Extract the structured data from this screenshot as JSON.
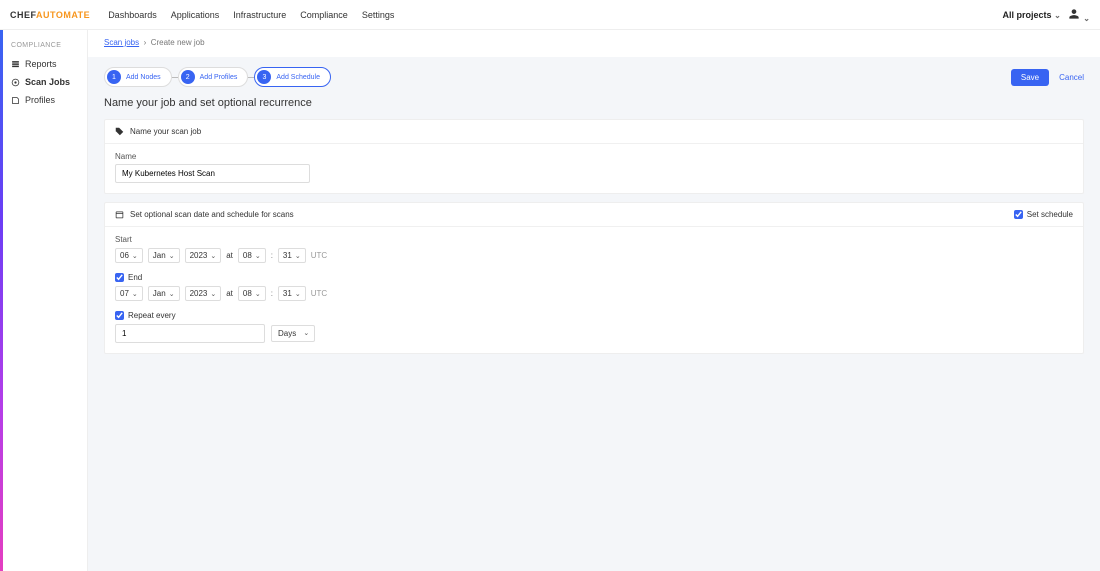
{
  "brand": {
    "part1": "CHEF",
    "part2": "AUTOMATE"
  },
  "topnav": {
    "links": [
      "Dashboards",
      "Applications",
      "Infrastructure",
      "Compliance",
      "Settings"
    ],
    "projects": "All projects"
  },
  "sidebar": {
    "section": "COMPLIANCE",
    "items": [
      {
        "label": "Reports"
      },
      {
        "label": "Scan Jobs"
      },
      {
        "label": "Profiles"
      }
    ]
  },
  "breadcrumb": {
    "root": "Scan jobs",
    "current": "Create new job"
  },
  "stepper": {
    "steps": [
      {
        "num": "1",
        "label": "Add Nodes"
      },
      {
        "num": "2",
        "label": "Add Profiles"
      },
      {
        "num": "3",
        "label": "Add Schedule"
      }
    ]
  },
  "actions": {
    "save": "Save",
    "cancel": "Cancel"
  },
  "heading": "Name your job and set optional recurrence",
  "nameCard": {
    "title": "Name your scan job",
    "label": "Name",
    "value": "My Kubernetes Host Scan"
  },
  "scheduleCard": {
    "title": "Set optional scan date and schedule for scans",
    "setScheduleLabel": "Set schedule",
    "setScheduleChecked": true,
    "startLabel": "Start",
    "start": {
      "day": "06",
      "month": "Jan",
      "year": "2023",
      "at": "at",
      "hour": "08",
      "sep": ":",
      "minute": "31",
      "tz": "UTC"
    },
    "endLabel": "End",
    "endChecked": true,
    "end": {
      "day": "07",
      "month": "Jan",
      "year": "2023",
      "at": "at",
      "hour": "08",
      "sep": ":",
      "minute": "31",
      "tz": "UTC"
    },
    "repeatLabel": "Repeat every",
    "repeatChecked": true,
    "repeat": {
      "value": "1",
      "unit": "Days"
    }
  }
}
